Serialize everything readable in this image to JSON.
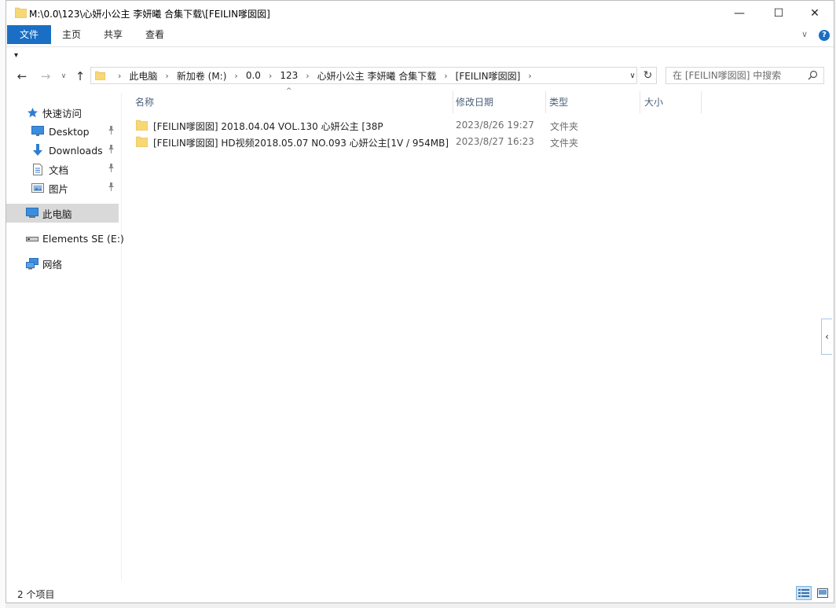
{
  "window": {
    "title": "M:\\0.0\\123\\心妍小公主 李妍曦 合集下载\\[FEILIN嗲囡囡]",
    "minimize_glyph": "—",
    "maximize_glyph": "☐",
    "close_glyph": "✕"
  },
  "ribbon": {
    "tabs": [
      "文件",
      "主页",
      "共享",
      "查看"
    ],
    "expand_glyph": "∨",
    "help_glyph": "?"
  },
  "quick_access_toolbar": {
    "glyph": "▾"
  },
  "navigation": {
    "back_glyph": "←",
    "forward_glyph": "→",
    "recent_glyph": "∨",
    "up_glyph": "↑"
  },
  "address_bar": {
    "breadcrumbs": [
      "此电脑",
      "新加卷 (M:)",
      "0.0",
      "123",
      "心妍小公主 李妍曦 合集下载",
      "[FEILIN嗲囡囡]"
    ],
    "separator": "›",
    "dropdown_glyph": "∨",
    "refresh_glyph": "↻"
  },
  "search": {
    "placeholder": "在 [FEILIN嗲囡囡] 中搜索",
    "value": ""
  },
  "nav_pane": {
    "items": [
      {
        "label": "快速访问",
        "icon": "star-icon",
        "pinned": false
      },
      {
        "label": "Desktop",
        "icon": "desktop-icon",
        "pinned": true
      },
      {
        "label": "Downloads",
        "icon": "download-icon",
        "pinned": true
      },
      {
        "label": "文档",
        "icon": "document-icon",
        "pinned": true
      },
      {
        "label": "图片",
        "icon": "picture-icon",
        "pinned": true
      },
      {
        "label": "此电脑",
        "icon": "computer-icon",
        "selected": true
      },
      {
        "label": "Elements SE (E:)",
        "icon": "drive-icon"
      },
      {
        "label": "网络",
        "icon": "network-icon"
      }
    ],
    "pin_glyph": "📌"
  },
  "file_list": {
    "columns": [
      "名称",
      "修改日期",
      "类型",
      "大小"
    ],
    "sort_glyph": "^",
    "rows": [
      {
        "name": "[FEILIN嗲囡囡] 2018.04.04 VOL.130 心妍公主 [38P",
        "date": "2023/8/26 19:27",
        "type": "文件夹",
        "size": ""
      },
      {
        "name": "[FEILIN嗲囡囡] HD视频2018.05.07 NO.093 心妍公主[1V / 954MB]",
        "date": "2023/8/27 16:23",
        "type": "文件夹",
        "size": ""
      }
    ]
  },
  "details_pane_toggle": {
    "glyph": "‹"
  },
  "status_bar": {
    "item_count": "2 个项目"
  },
  "colors": {
    "file_tab": "#1a6fc4",
    "folder_yellow": "#f8d775",
    "selection": "#d9d9d9",
    "column_header_text": "#4a5f7a"
  }
}
